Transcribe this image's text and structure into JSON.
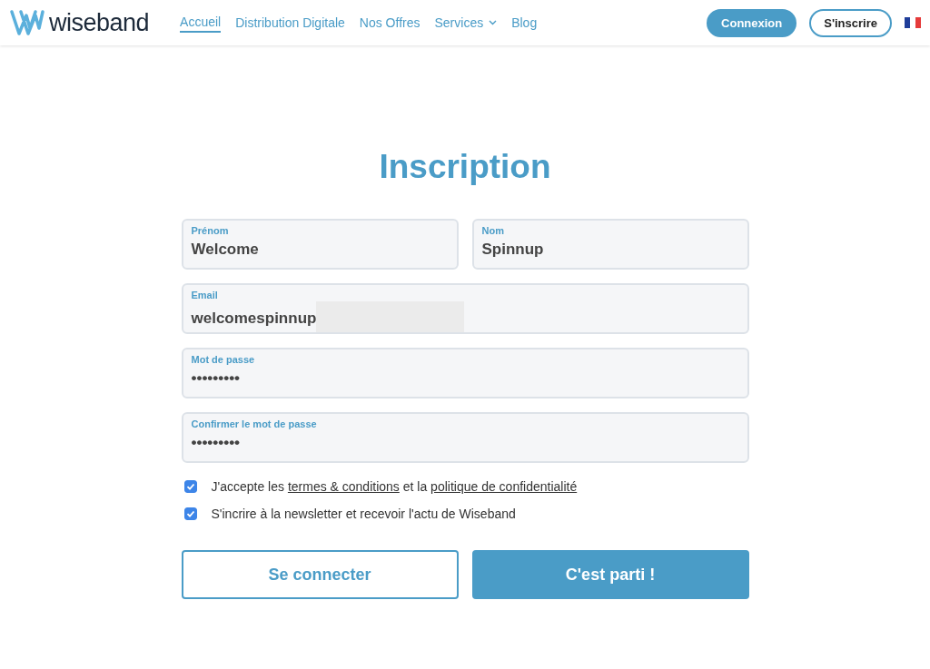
{
  "header": {
    "brand": "wiseband",
    "nav": [
      {
        "label": "Accueil",
        "selected": true,
        "dropdown": false
      },
      {
        "label": "Distribution Digitale",
        "selected": false,
        "dropdown": false
      },
      {
        "label": "Nos Offres",
        "selected": false,
        "dropdown": false
      },
      {
        "label": "Services",
        "selected": false,
        "dropdown": true
      },
      {
        "label": "Blog",
        "selected": false,
        "dropdown": false
      }
    ],
    "login": "Connexion",
    "signup": "S'inscrire"
  },
  "title": "Inscription",
  "fields": [
    {
      "label": "Prénom",
      "value": "Welcome",
      "redacted": false
    },
    {
      "label": "Nom",
      "value": "Spinnup",
      "redacted": false
    },
    {
      "label": "Email",
      "value": "welcomespinnup",
      "redacted": true
    },
    {
      "label": "Mot de passe",
      "value": "•••••••••",
      "redacted": false
    },
    {
      "label": "Confirmer le mot de passe",
      "value": "•••••••••",
      "redacted": false
    }
  ],
  "consents": [
    {
      "checked": true,
      "parts": [
        {
          "text": "J'accepte les ",
          "kind": "text"
        },
        {
          "text": "termes & conditions",
          "kind": "link"
        },
        {
          "text": " et la ",
          "kind": "text"
        },
        {
          "text": "politique de confidentialité",
          "kind": "link"
        }
      ]
    },
    {
      "checked": true,
      "parts": [
        {
          "text": "S'incrire à la newsletter et recevoir l'actu de Wiseband",
          "kind": "text"
        }
      ]
    }
  ],
  "buttons": [
    {
      "label": "Se connecter",
      "kind": "secondary"
    },
    {
      "label": "C'est parti !",
      "kind": "primary"
    }
  ]
}
